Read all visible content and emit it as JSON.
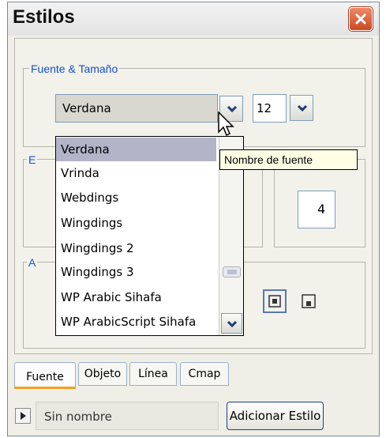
{
  "window": {
    "title": "Estilos"
  },
  "font_group": {
    "label": "Fuente & Tamaño",
    "font_value": "Verdana",
    "size_value": "12"
  },
  "groups": {
    "second_label_fragment": "E",
    "third_label_fragment": "A"
  },
  "number_box": {
    "value": "4"
  },
  "dropdown": {
    "items": [
      "Verdana",
      "Vrinda",
      "Webdings",
      "Wingdings",
      "Wingdings 2",
      "Wingdings 3",
      "WP Arabic Sihafa",
      "WP ArabicScript Sihafa"
    ],
    "selected": "Verdana"
  },
  "tooltip": {
    "text": "Nombre de fuente"
  },
  "tabs": [
    {
      "label": "Fuente",
      "active": true
    },
    {
      "label": "Objeto",
      "active": false
    },
    {
      "label": "Línea",
      "active": false
    },
    {
      "label": "Cmap",
      "active": false
    }
  ],
  "footer": {
    "style_name": "Sin nombre",
    "add_style_label": "Adicionar Estilo"
  },
  "colors": {
    "group_label": "#1550cc",
    "close_button": "#d85a34",
    "selection": "#b4b4c8",
    "active_tab_underline": "#f0a020",
    "tooltip_bg": "#ffffe6"
  },
  "icons": [
    "close-icon",
    "chevron-down-icon",
    "play-icon",
    "align-center-icon",
    "align-bottom-icon",
    "scroll-thumb-grip-icon",
    "mouse-cursor-icon"
  ]
}
